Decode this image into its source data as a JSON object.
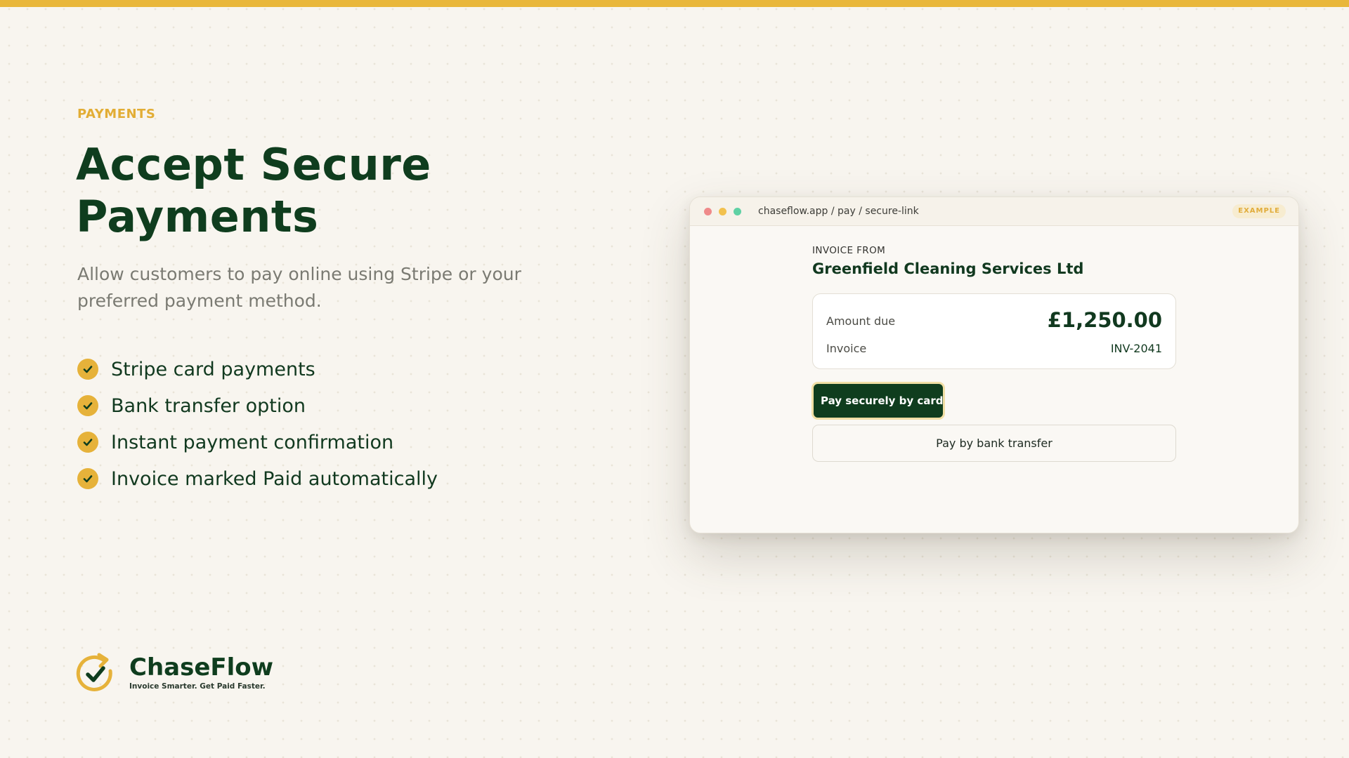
{
  "hero": {
    "eyebrow": "PAYMENTS",
    "title": "Accept Secure Payments",
    "subtitle": "Allow customers to pay online using Stripe or your preferred payment method.",
    "features": [
      "Stripe card payments",
      "Bank transfer option",
      "Instant payment confirmation",
      "Invoice marked Paid automatically"
    ]
  },
  "brand": {
    "name": "ChaseFlow",
    "tagline": "Invoice Smarter. Get Paid Faster.",
    "accent_color": "#e9b73a",
    "primary_color": "#0f3d1e",
    "logo_icon": "refresh-check-icon"
  },
  "browser": {
    "url": "chaseflow.app / pay / secure-link",
    "badge": "EXAMPLE",
    "invoice_from_label": "INVOICE FROM",
    "company": "Greenfield Cleaning Services Ltd",
    "amount_label": "Amount due",
    "amount_value": "£1,250.00",
    "invoice_label": "Invoice",
    "invoice_number": "INV-2041",
    "pay_card_label": "Pay securely by card",
    "pay_card_icon": "credit-card-icon",
    "pay_bank_label": "Pay by bank transfer"
  },
  "icons": {
    "feature_check": "check-circle-icon"
  }
}
